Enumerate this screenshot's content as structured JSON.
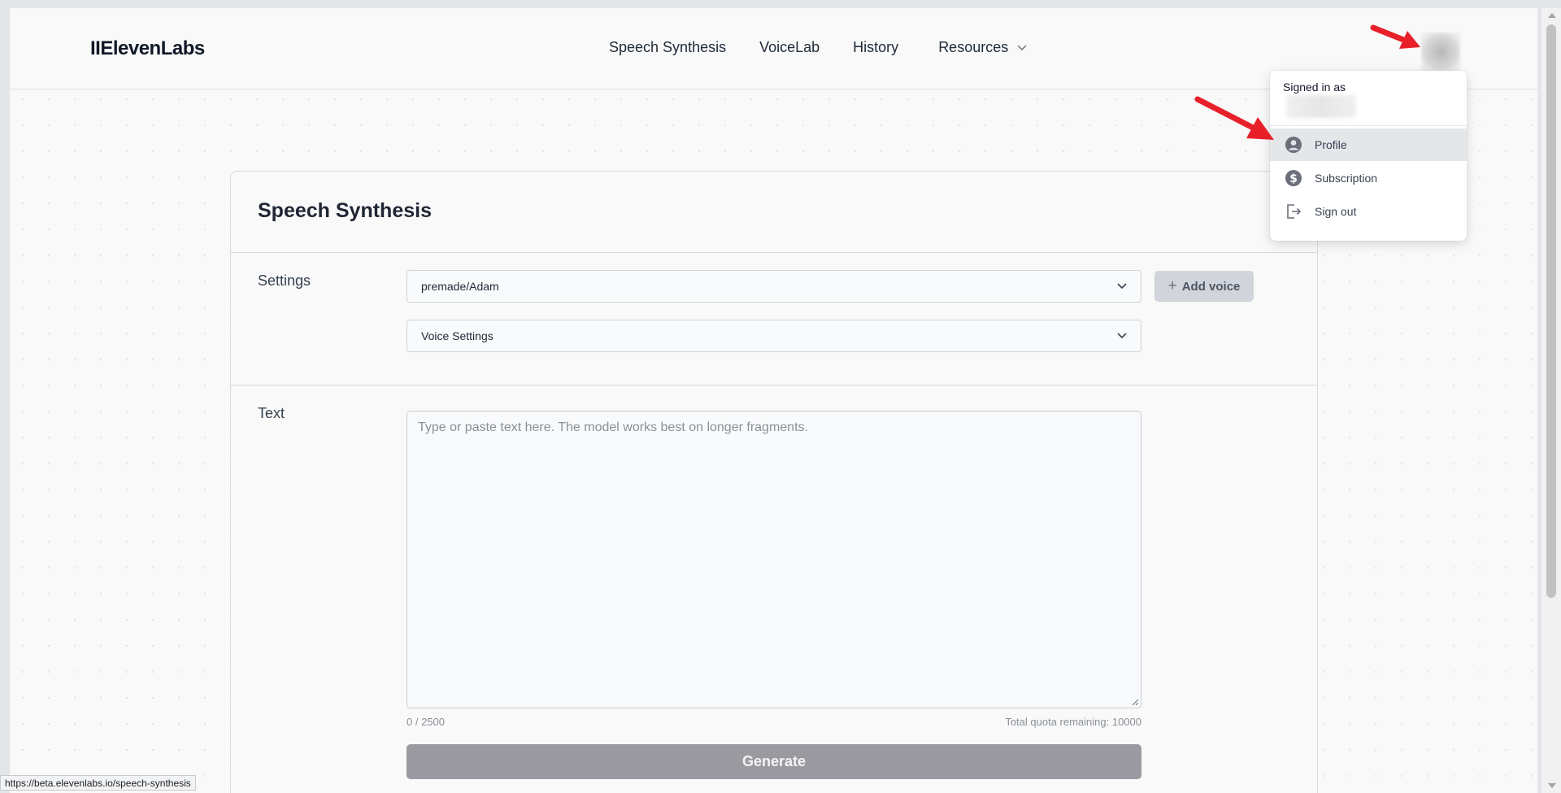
{
  "header": {
    "logo": "IIElevenLabs",
    "nav": [
      {
        "label": "Speech Synthesis"
      },
      {
        "label": "VoiceLab"
      },
      {
        "label": "History"
      },
      {
        "label": "Resources"
      }
    ]
  },
  "main": {
    "title": "Speech Synthesis",
    "settings_label": "Settings",
    "voice_select": "premade/Adam",
    "voice_settings": "Voice Settings",
    "add_voice": "Add voice",
    "text_label": "Text",
    "text_placeholder": "Type or paste text here. The model works best on longer fragments.",
    "char_count": "0 / 2500",
    "quota": "Total quota remaining: 10000",
    "generate": "Generate"
  },
  "user_menu": {
    "header": "Signed in as",
    "items": [
      {
        "label": "Profile",
        "icon": "user-circle-icon"
      },
      {
        "label": "Subscription",
        "icon": "dollar-circle-icon"
      },
      {
        "label": "Sign out",
        "icon": "sign-out-icon"
      }
    ]
  },
  "status_url": "https://beta.elevenlabs.io/speech-synthesis",
  "colors": {
    "arrow": "#e8202a",
    "generate_bg": "#9b9aa1",
    "page_bg": "#f8f9f8"
  }
}
